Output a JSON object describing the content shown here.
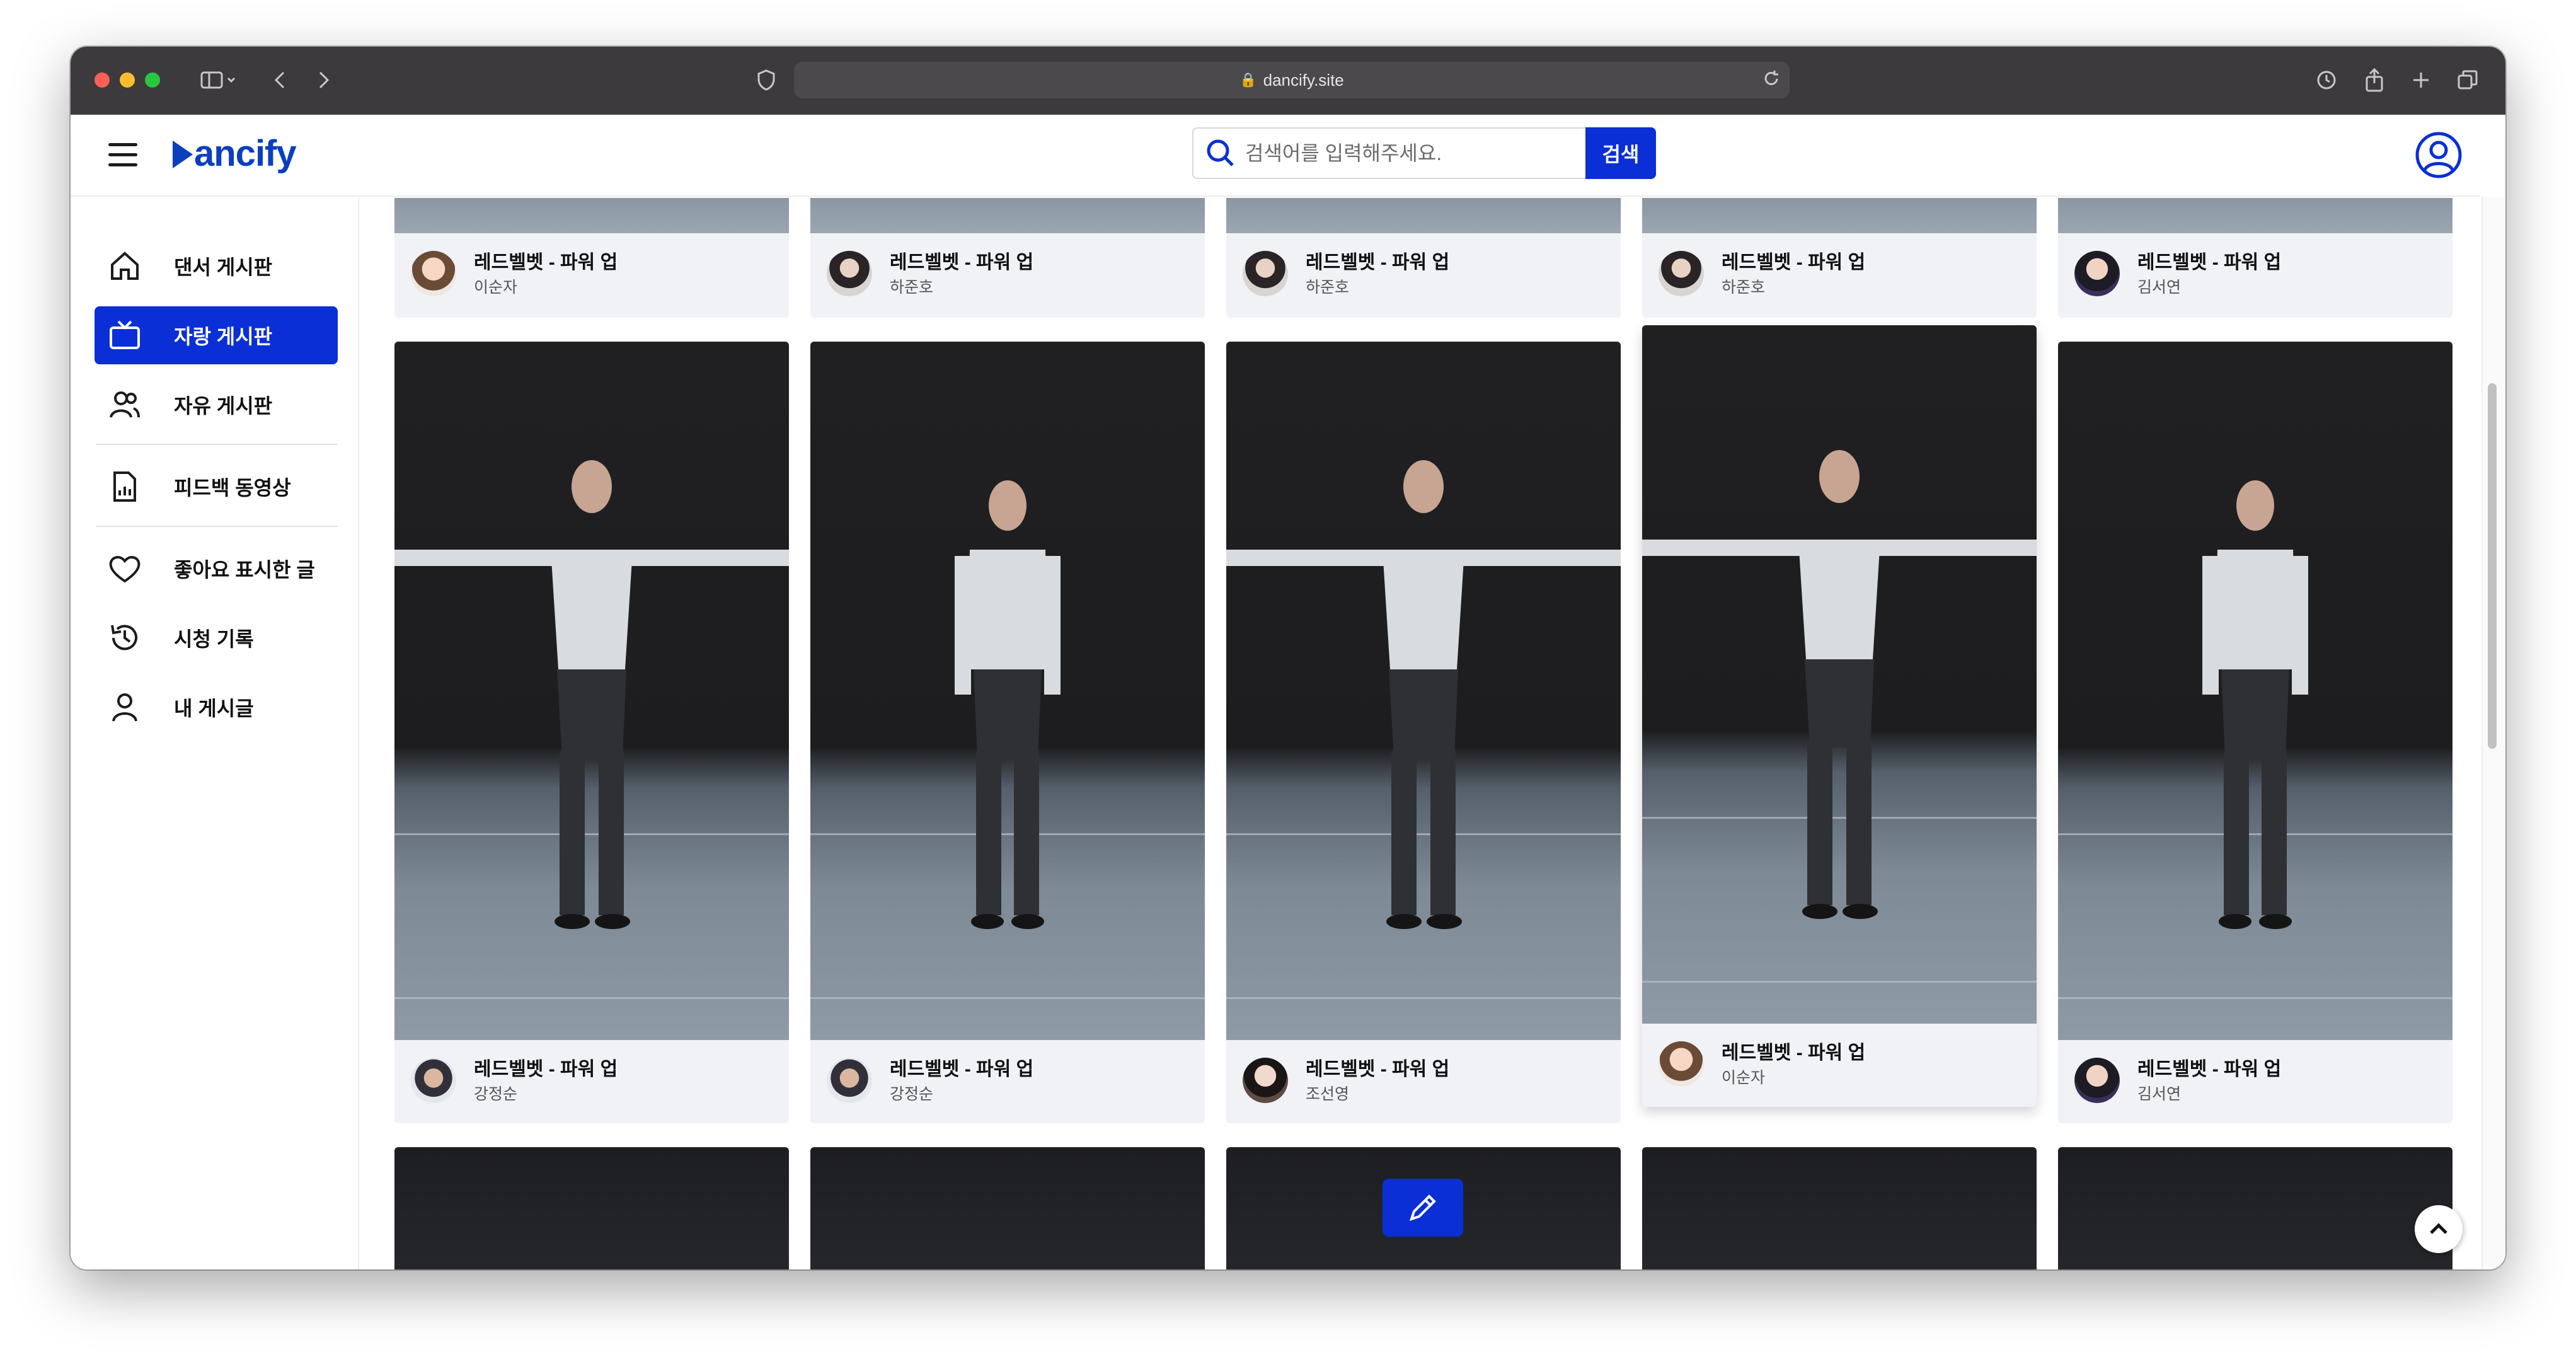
{
  "browser": {
    "url": "dancify.site"
  },
  "header": {
    "logo_text": "ancify",
    "search_placeholder": "검색어를 입력해주세요.",
    "search_button": "검색"
  },
  "sidebar": {
    "items": [
      {
        "label": "댄서 게시판",
        "icon": "home-icon"
      },
      {
        "label": "자랑 게시판",
        "icon": "tv-icon",
        "active": true
      },
      {
        "label": "자유 게시판",
        "icon": "users-icon"
      },
      {
        "label": "피드백 동영상",
        "icon": "document-chart-icon"
      },
      {
        "label": "좋아요 표시한 글",
        "icon": "heart-icon"
      },
      {
        "label": "시청 기록",
        "icon": "history-icon"
      },
      {
        "label": "내 게시글",
        "icon": "user-icon"
      }
    ]
  },
  "posts": {
    "row1": [
      {
        "title": "레드벨벳 - 파워 업",
        "author": "이순자"
      },
      {
        "title": "레드벨벳 - 파워 업",
        "author": "하준호"
      },
      {
        "title": "레드벨벳 - 파워 업",
        "author": "하준호"
      },
      {
        "title": "레드벨벳 - 파워 업",
        "author": "하준호"
      },
      {
        "title": "레드벨벳 - 파워 업",
        "author": "김서연"
      }
    ],
    "row2": [
      {
        "title": "레드벨벳 - 파워 업",
        "author": "강정순"
      },
      {
        "title": "레드벨벳 - 파워 업",
        "author": "강정순"
      },
      {
        "title": "레드벨벳 - 파워 업",
        "author": "조선영"
      },
      {
        "title": "레드벨벳 - 파워 업",
        "author": "이순자"
      },
      {
        "title": "레드벨벳 - 파워 업",
        "author": "김서연"
      }
    ]
  },
  "colors": {
    "accent": "#0a2fd6",
    "logo": "#0b3fbf"
  }
}
